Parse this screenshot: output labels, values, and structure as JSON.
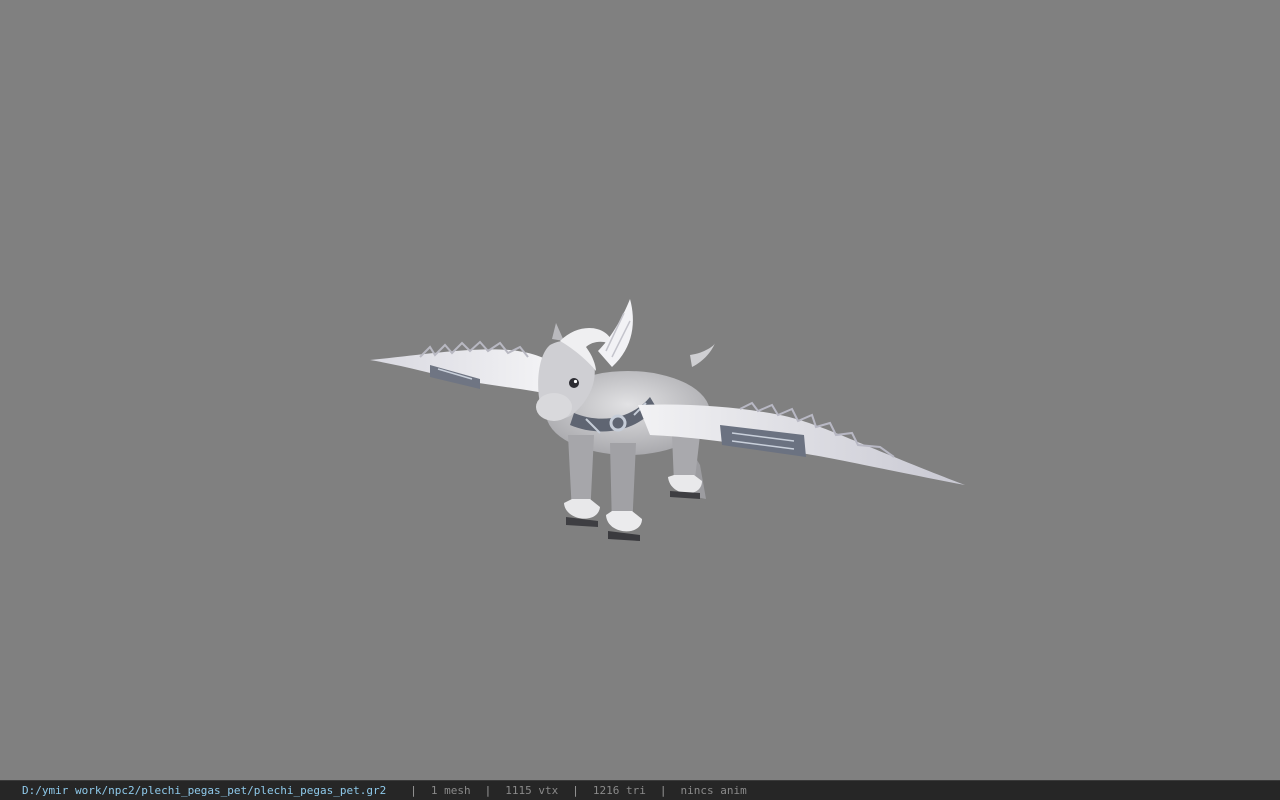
{
  "status_bar": {
    "file_path": "D:/ymir work/npc2/plechi_pegas_pet/plechi_pegas_pet.gr2",
    "separator": "|",
    "mesh_count": "1 mesh",
    "vertex_count": "1115 vtx",
    "triangle_count": "1216 tri",
    "animation": "nincs anim"
  },
  "viewport": {
    "background_color": "#808080",
    "model_subject": "winged pony pet (pegasus)"
  }
}
